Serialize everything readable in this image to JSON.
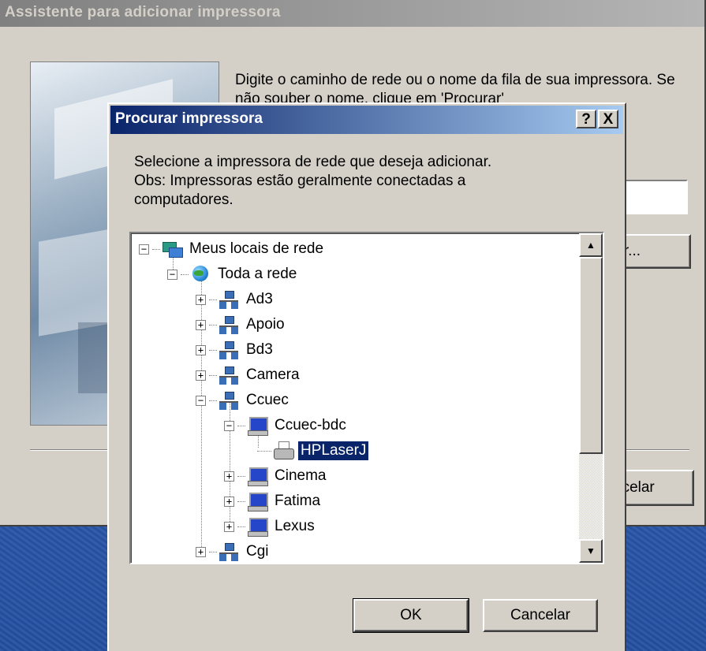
{
  "wizard": {
    "title": "Assistente para adicionar impressora",
    "description": "Digite o caminho de rede ou o nome da fila de sua impressora. Se não souber o nome, clique em 'Procurar'",
    "browse_label": "rar...",
    "cancel_label": "ncelar"
  },
  "dialog": {
    "title": "Procurar impressora",
    "help_label": "?",
    "close_label": "X",
    "description": "Selecione a impressora de rede que deseja adicionar.\nObs: Impressoras estão geralmente conectadas a\ncomputadores.",
    "ok_label": "OK",
    "cancel_label": "Cancelar"
  },
  "tree": {
    "items": [
      {
        "label": "Meus locais de rede",
        "icon": "network-places-icon",
        "expander": "−"
      },
      {
        "label": "Toda a rede",
        "icon": "globe-icon",
        "expander": "−"
      },
      {
        "label": "Ad3",
        "icon": "domain-icon",
        "expander": "+"
      },
      {
        "label": "Apoio",
        "icon": "domain-icon",
        "expander": "+"
      },
      {
        "label": "Bd3",
        "icon": "domain-icon",
        "expander": "+"
      },
      {
        "label": "Camera",
        "icon": "domain-icon",
        "expander": "+"
      },
      {
        "label": "Ccuec",
        "icon": "domain-icon",
        "expander": "−"
      },
      {
        "label": "Ccuec-bdc",
        "icon": "computer-icon",
        "expander": "−"
      },
      {
        "label": "HPLaserJ",
        "icon": "printer-icon",
        "expander": "",
        "selected": true
      },
      {
        "label": "Cinema",
        "icon": "computer-icon",
        "expander": "+"
      },
      {
        "label": "Fatima",
        "icon": "computer-icon",
        "expander": "+"
      },
      {
        "label": "Lexus",
        "icon": "computer-icon",
        "expander": "+"
      },
      {
        "label": "Cgi",
        "icon": "domain-icon",
        "expander": "+"
      }
    ]
  },
  "scrollbar": {
    "up_arrow": "▲",
    "down_arrow": "▼"
  }
}
